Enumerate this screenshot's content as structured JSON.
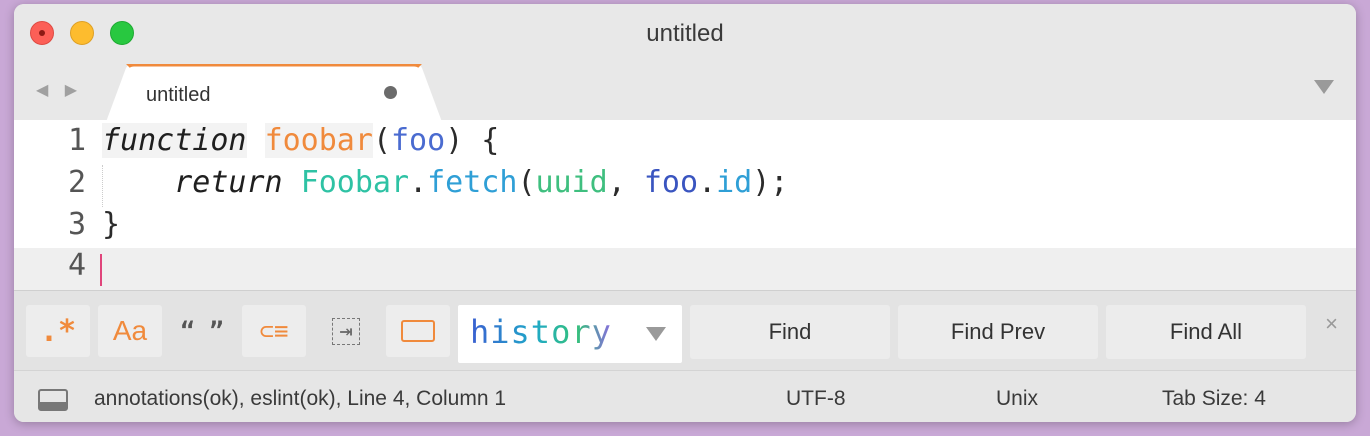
{
  "window": {
    "title": "untitled"
  },
  "tab": {
    "label": "untitled"
  },
  "editor": {
    "line_numbers": [
      "1",
      "2",
      "3",
      "4"
    ],
    "line1": {
      "kw": "function",
      "fn": "foobar",
      "p1": "(",
      "param": "foo",
      "p2": ") {"
    },
    "line2": {
      "indent": "    ",
      "kw": "return",
      "sp": " ",
      "cls": "Foobar",
      "dot": ".",
      "method": "fetch",
      "p1": "(",
      "uuid": "uuid",
      "comma": ", ",
      "foo": "foo",
      "dot2": ".",
      "id": "id",
      "end": ");"
    },
    "line3": {
      "brace": "}"
    }
  },
  "findbar": {
    "regex_label": ".*",
    "case_label": "Aa",
    "word_label": "“ ”",
    "wrap_label": "⊂≡",
    "selection_label": "⇥",
    "find_value": "history",
    "find_button": "Find",
    "find_prev_button": "Find Prev",
    "find_all_button": "Find All",
    "close_label": "×"
  },
  "statusbar": {
    "status": "annotations(ok), eslint(ok), Line 4, Column 1",
    "encoding": "UTF-8",
    "line_endings": "Unix",
    "tab_size": "Tab Size: 4"
  },
  "icons": {
    "nav_arrows": "◀ ▶"
  },
  "colors": {
    "accent": "#f08a3c",
    "cursor": "#e0457b"
  }
}
